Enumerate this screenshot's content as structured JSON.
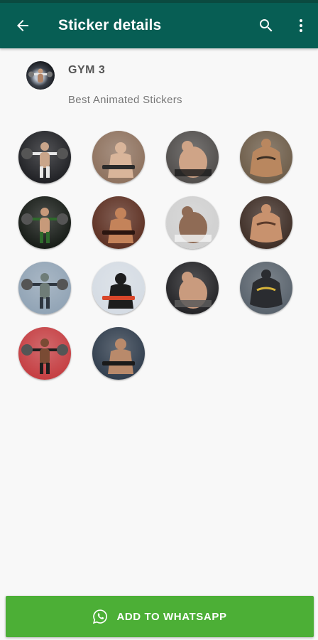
{
  "appbar": {
    "title": "Sticker details",
    "back_icon": "arrow-left-icon",
    "search_icon": "search-icon",
    "more_icon": "more-vert-icon",
    "color": "#075e54"
  },
  "pack": {
    "name": "GYM 3",
    "publisher": "Best Animated Stickers"
  },
  "stickers": [
    {
      "subject": "barbell lift",
      "bg": "#1b1c20",
      "fg": "#c9a58a",
      "accent": "#e8e8e8"
    },
    {
      "subject": "seated machine workout",
      "bg": "#8c6f5b",
      "fg": "#d9b59a",
      "accent": "#2b2b2b"
    },
    {
      "subject": "dumbbell row",
      "bg": "#4d4a48",
      "fg": "#cfa487",
      "accent": "#1e1e1e"
    },
    {
      "subject": "bodybuilder pose",
      "bg": "#6b5a46",
      "fg": "#b9875f",
      "accent": "#3a2e24"
    },
    {
      "subject": "kettlebell swing",
      "bg": "#111611",
      "fg": "#c79a7a",
      "accent": "#2f6a2c"
    },
    {
      "subject": "hand grip strength",
      "bg": "#5a2c1e",
      "fg": "#c4835a",
      "accent": "#2a1510"
    },
    {
      "subject": "hooded athlete",
      "bg": "#cfcfcf",
      "fg": "#8f6b55",
      "accent": "#f2f2f2"
    },
    {
      "subject": "clenched fist",
      "bg": "#3b2a22",
      "fg": "#c8926e",
      "accent": "#5a3a2a"
    },
    {
      "subject": "pull-up bar",
      "bg": "#8fa2b4",
      "fg": "#6f7d78",
      "accent": "#2e3640"
    },
    {
      "subject": "jump rope",
      "bg": "#d4dbe3",
      "fg": "#1d1d1d",
      "accent": "#d8462a"
    },
    {
      "subject": "squat rack",
      "bg": "#1f1f22",
      "fg": "#c99b7e",
      "accent": "#5a5a5a"
    },
    {
      "subject": "medicine ball",
      "bg": "#56606a",
      "fg": "#2a2c30",
      "accent": "#d7b43a"
    },
    {
      "subject": "boxer with glove",
      "bg": "#c43a3e",
      "fg": "#7a4b34",
      "accent": "#1e1e1e"
    },
    {
      "subject": "muscular back",
      "bg": "#2d3a4a",
      "fg": "#b98a6b",
      "accent": "#1a1a1a"
    }
  ],
  "action": {
    "label": "ADD TO WHATSAPP",
    "icon": "whatsapp-icon",
    "color": "#4caf36"
  }
}
